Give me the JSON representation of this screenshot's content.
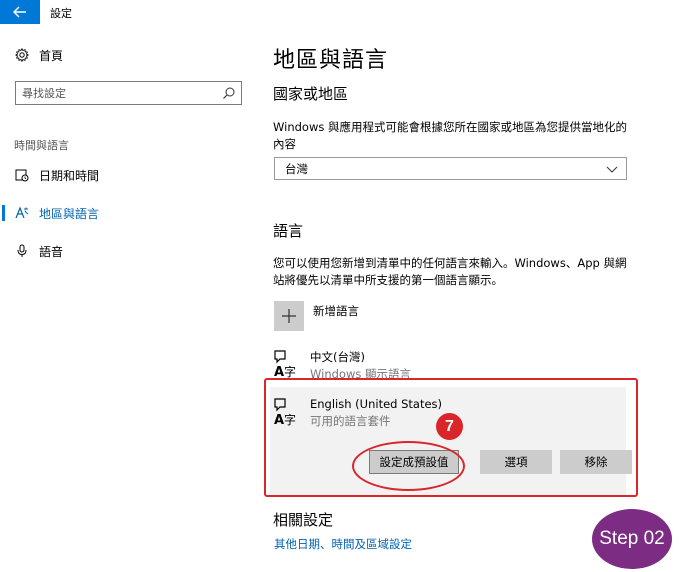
{
  "window": {
    "title": "設定",
    "back_icon": "arrow-left-icon"
  },
  "sidebar": {
    "home_label": "首頁",
    "search": {
      "placeholder": "尋找設定"
    },
    "section_label": "時間與語言",
    "items": [
      {
        "label": "日期和時間",
        "icon": "calendar-clock-icon"
      },
      {
        "label": "地區與語言",
        "icon": "region-language-icon",
        "active": true
      },
      {
        "label": "語音",
        "icon": "microphone-icon"
      }
    ]
  },
  "main": {
    "title": "地區與語言",
    "region": {
      "heading": "國家或地區",
      "description": "Windows 與應用程式可能會根據您所在國家或地區為您提供當地化的內容",
      "selected": "台灣"
    },
    "languages": {
      "heading": "語言",
      "description": "您可以使用您新增到清單中的任何語言來輸入。Windows、App 與網站將優先以清單中所支援的第一個語言顯示。",
      "add_label": "新增語言",
      "items": [
        {
          "name": "中文(台灣)",
          "status": "Windows 顯示語言"
        },
        {
          "name": "English (United States)",
          "status": "可用的語言套件"
        }
      ],
      "buttons": {
        "set_default": "設定成預設值",
        "options": "選項",
        "remove": "移除"
      }
    },
    "related": {
      "heading": "相關設定",
      "link": "其他日期、時間及區域設定"
    }
  },
  "annotations": {
    "step_number": "7",
    "step_badge": "Step 02",
    "highlight_color": "#d9262b",
    "badge_color": "#7c2c83",
    "accent_color": "#0078d7"
  }
}
